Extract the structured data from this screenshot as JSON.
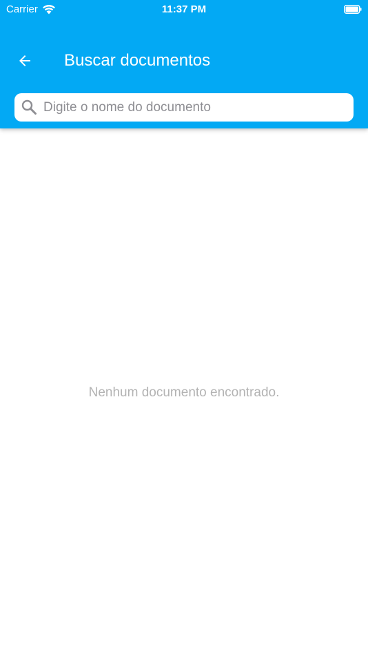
{
  "status_bar": {
    "carrier": "Carrier",
    "time": "11:37 PM"
  },
  "header": {
    "title": "Buscar documentos",
    "back_icon": "arrow-left-icon"
  },
  "search": {
    "placeholder": "Digite o nome do documento",
    "value": "",
    "icon": "search-icon"
  },
  "content": {
    "empty_message": "Nenhum documento encontrado."
  },
  "colors": {
    "primary": "#03a9f4",
    "background": "#ffffff",
    "empty_text": "#b3b3b3",
    "placeholder": "#8e8e93"
  }
}
